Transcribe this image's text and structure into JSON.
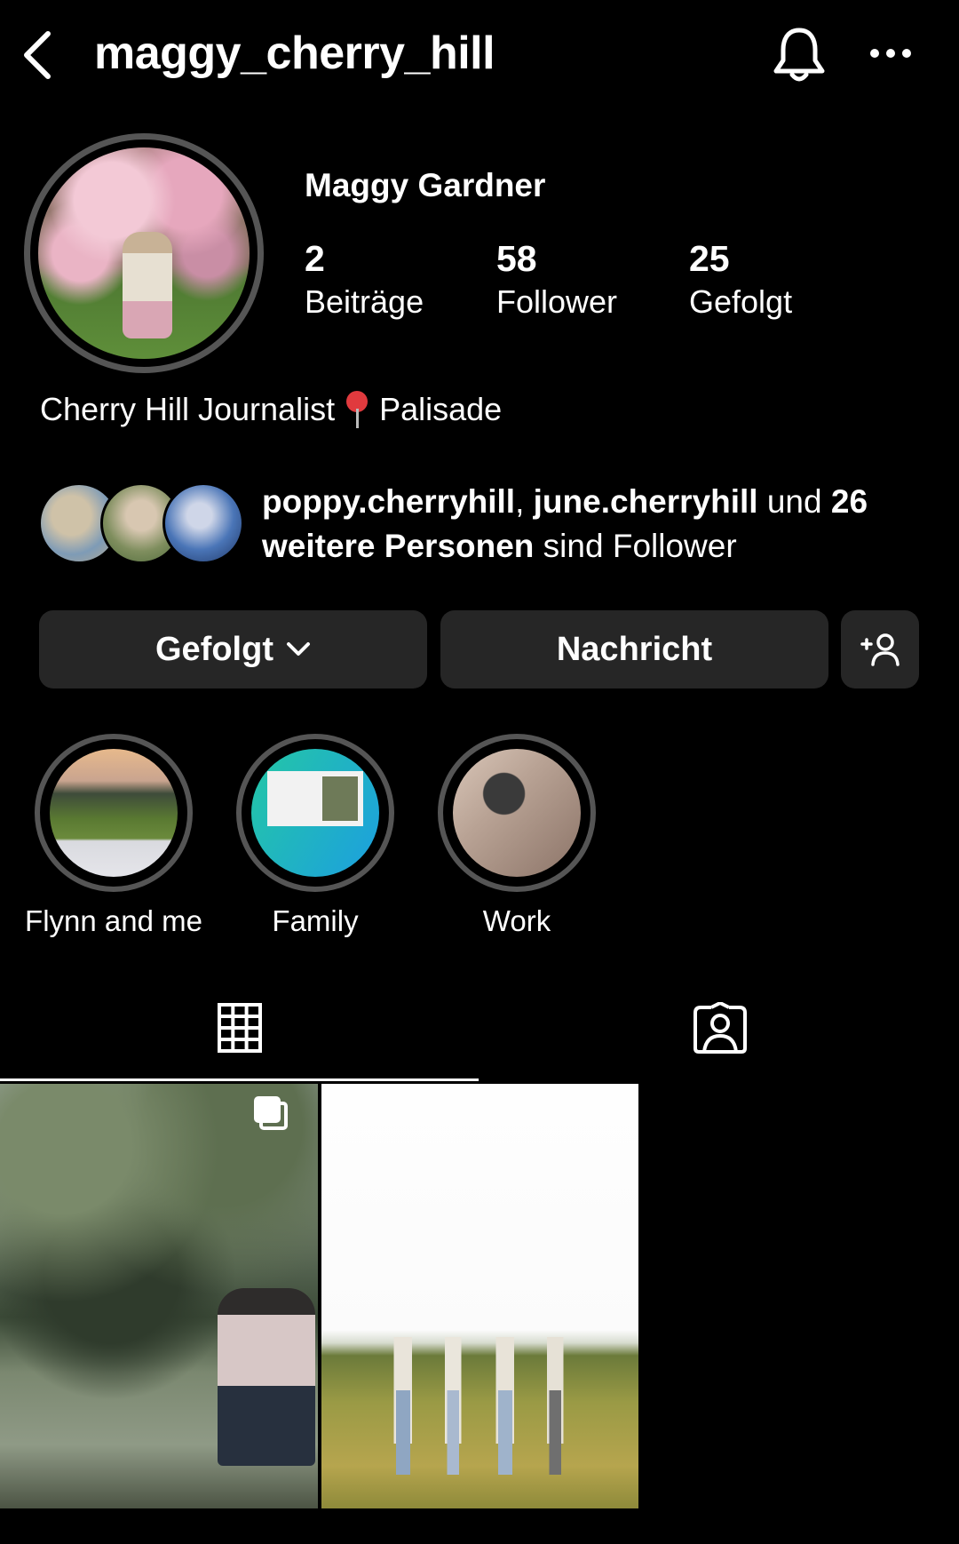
{
  "header": {
    "username": "maggy_cherry_hill",
    "back_icon": "chevron-left-icon",
    "bell_icon": "bell-icon",
    "more_icon": "more-horizontal-icon"
  },
  "profile": {
    "full_name": "Maggy Gardner",
    "stats": [
      {
        "value": "2",
        "label": "Beiträge"
      },
      {
        "value": "58",
        "label": "Follower"
      },
      {
        "value": "25",
        "label": "Gefolgt"
      }
    ],
    "bio": {
      "text": "Cherry Hill Journalist",
      "pin_emoji": "📍",
      "location": "Palisade"
    }
  },
  "followed_by": {
    "user1": "poppy.cherryhill",
    "separator": ", ",
    "user2": "june.cherryhill",
    "and_word": " und ",
    "others": "26 weitere Personen",
    "suffix": " sind Follower"
  },
  "actions": {
    "follow_label": "Gefolgt",
    "message_label": "Nachricht",
    "add_user_icon": "add-person-icon"
  },
  "highlights": [
    {
      "label": "Flynn and me"
    },
    {
      "label": "Family"
    },
    {
      "label": "Work"
    }
  ],
  "tabs": {
    "grid_icon": "grid-icon",
    "tagged_icon": "tagged-person-icon",
    "active": "grid"
  },
  "posts": [
    {
      "kind": "carousel",
      "multi_icon": "multiple-photos-icon"
    },
    {
      "kind": "photo"
    }
  ]
}
